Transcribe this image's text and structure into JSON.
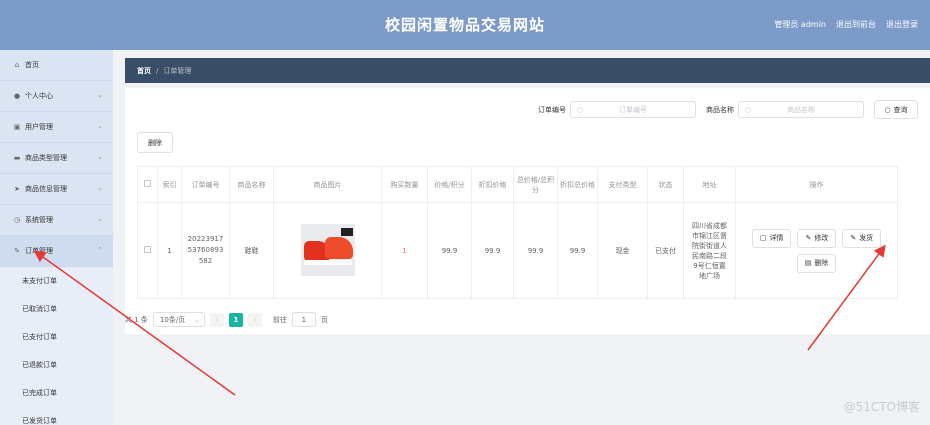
{
  "header": {
    "title": "校园闲置物品交易网站",
    "admin": "管理员 admin",
    "back_label": "退出到前台",
    "logout_label": "退出登录"
  },
  "sidebar": {
    "items": [
      {
        "label": "首页",
        "icon": "home-icon"
      },
      {
        "label": "个人中心",
        "icon": "user-icon"
      },
      {
        "label": "用户管理",
        "icon": "users-icon"
      },
      {
        "label": "商品类型管理",
        "icon": "category-icon"
      },
      {
        "label": "商品信息管理",
        "icon": "send-icon"
      },
      {
        "label": "系统管理",
        "icon": "settings-icon"
      },
      {
        "label": "订单管理",
        "icon": "order-icon"
      }
    ],
    "subitems": [
      "未支付订单",
      "已取消订单",
      "已支付订单",
      "已退款订单",
      "已完成订单",
      "已发货订单"
    ]
  },
  "breadcrumb": {
    "home": "首页",
    "sep": "/",
    "current": "订单管理"
  },
  "search": {
    "order_label": "订单编号",
    "order_placeholder": "订单编号",
    "name_label": "商品名称",
    "name_placeholder": "商品名称",
    "query_label": "查询"
  },
  "delete_label": "删除",
  "table": {
    "headers": [
      "索引",
      "订单编号",
      "商品名称",
      "商品图片",
      "购买数量",
      "价格/积分",
      "折扣价格",
      "总价格/总积分",
      "折扣总价格",
      "支付类型",
      "状态",
      "地址",
      "操作"
    ],
    "rows": [
      {
        "index": "1",
        "order_no": "20223917 53760893 582",
        "name": "鞋鞋",
        "qty": "1",
        "price": "99.9",
        "discount": "99.9",
        "total": "99.9",
        "discount_total": "99.9",
        "pay_type": "现金",
        "status": "已支付",
        "address": "四川省成都市锦江区督院街街道人民南路二段9号仁恒置地广场"
      }
    ],
    "ops": {
      "detail": "详情",
      "edit": "修改",
      "ship": "发货",
      "delete": "删除"
    }
  },
  "pager": {
    "total": "共 1 条",
    "size": "10条/页",
    "page": "1",
    "goto": "前往",
    "goto_value": "1",
    "unit": "页"
  },
  "watermark": "@51CTO博客",
  "colors": {
    "header": "#7d9bc9",
    "breadcrumb": "#3a4d66",
    "accent": "#17b3a3",
    "arrow": "#e53935"
  }
}
